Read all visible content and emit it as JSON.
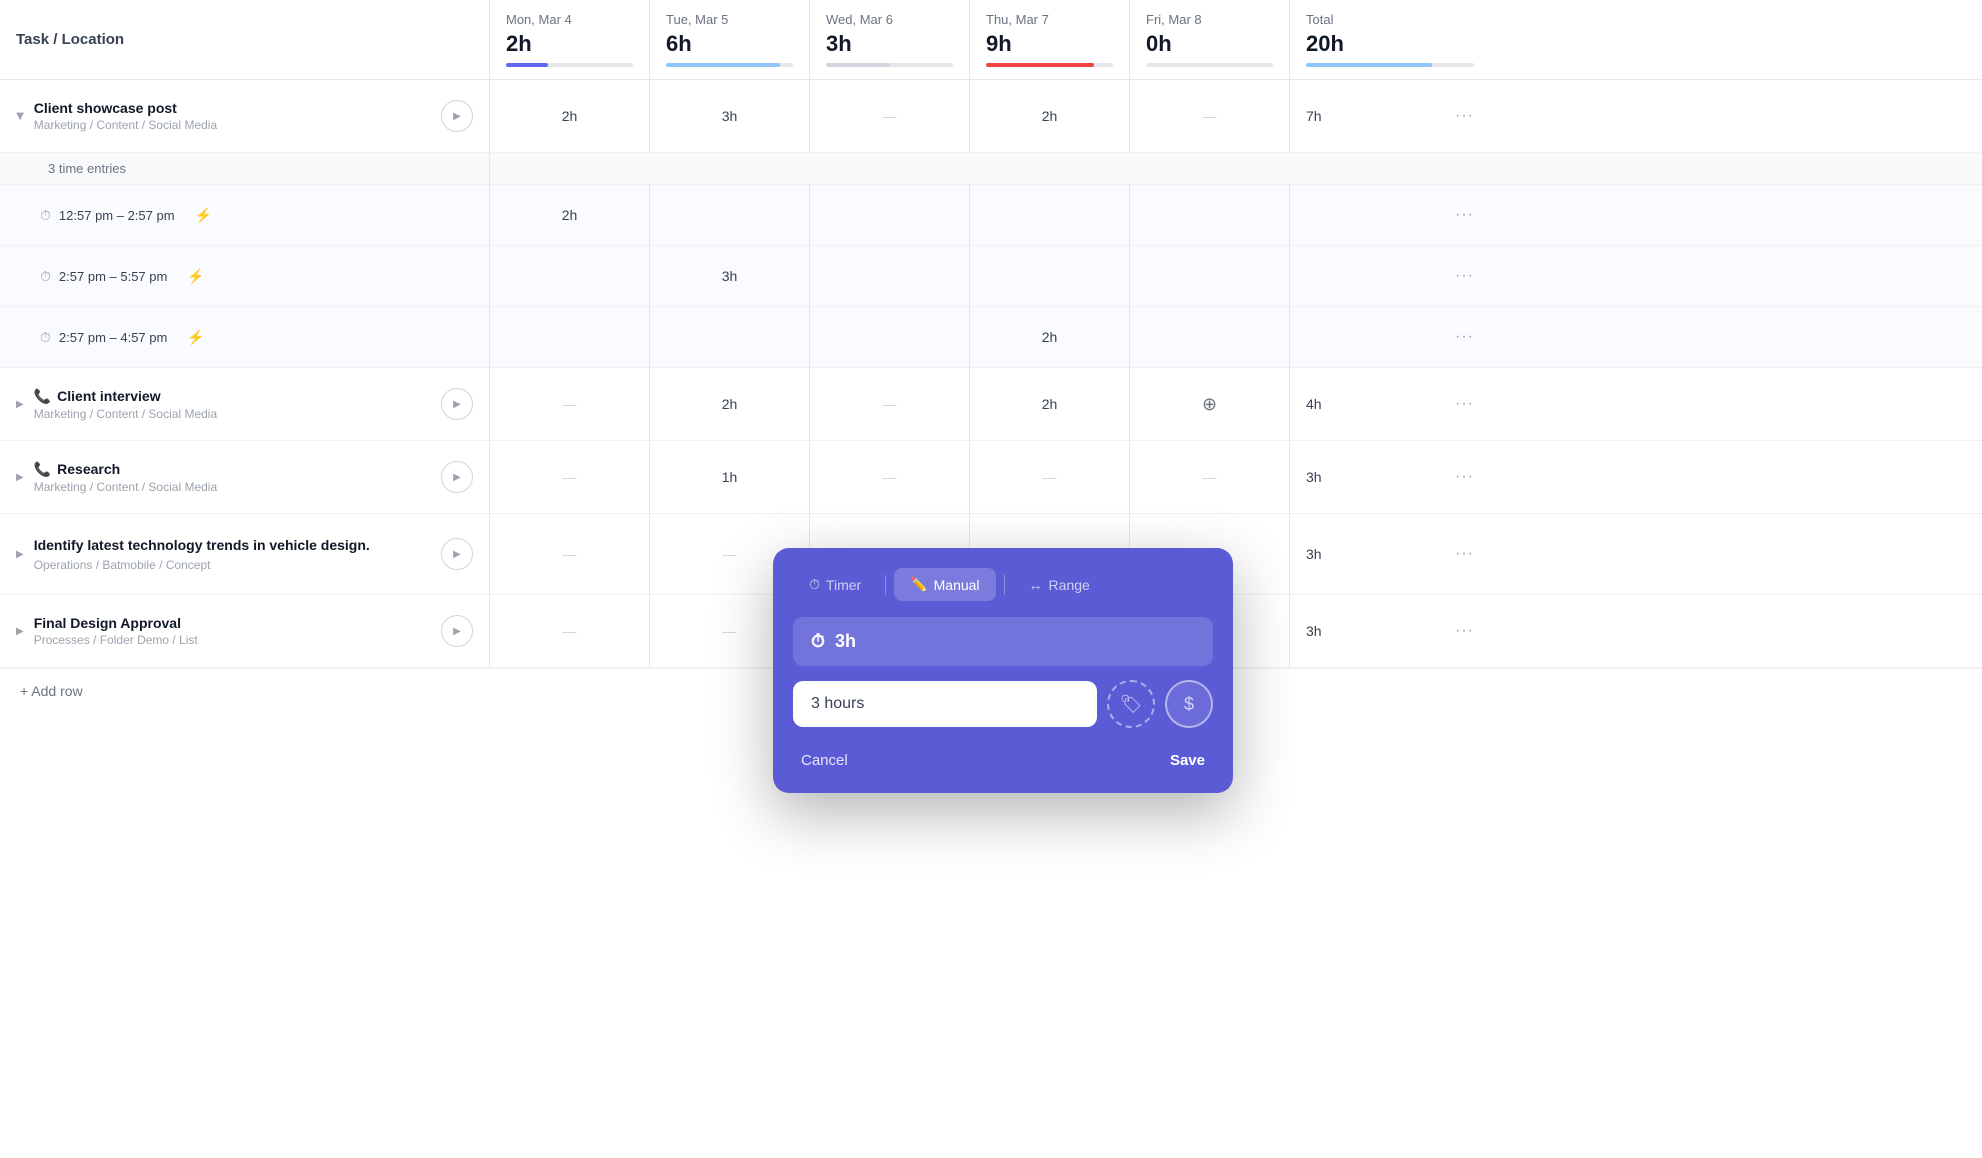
{
  "header": {
    "task_location_label": "Task / Location",
    "columns": [
      {
        "day": "Mon, Mar 4",
        "hours": "2h",
        "progress": 33,
        "color": "blue"
      },
      {
        "day": "Tue, Mar 5",
        "hours": "6h",
        "progress": 90,
        "color": "light-blue"
      },
      {
        "day": "Wed, Mar 6",
        "hours": "3h",
        "progress": 50,
        "color": "gray"
      },
      {
        "day": "Thu, Mar 7",
        "hours": "9h",
        "progress": 85,
        "color": "red"
      },
      {
        "day": "Fri, Mar 8",
        "hours": "0h",
        "progress": 0,
        "color": "gray"
      },
      {
        "day": "Total",
        "hours": "20h",
        "progress": 75,
        "color": "light-blue"
      }
    ]
  },
  "tasks": [
    {
      "id": "client-showcase",
      "name": "Client showcase post",
      "location": "Marketing / Content / Social Media",
      "expanded": true,
      "mon": "2h",
      "tue": "3h",
      "wed": "—",
      "thu": "2h",
      "fri": "—",
      "total": "7h",
      "icon": null,
      "time_entries_label": "3 time entries",
      "entries": [
        {
          "time": "12:57 pm – 2:57 pm",
          "mon": "2h",
          "tue": "",
          "wed": "",
          "thu": "",
          "fri": ""
        },
        {
          "time": "2:57 pm – 5:57 pm",
          "mon": "",
          "tue": "3h",
          "wed": "",
          "thu": "",
          "fri": ""
        },
        {
          "time": "2:57 pm – 4:57 pm",
          "mon": "",
          "tue": "",
          "wed": "",
          "thu": "2h",
          "fri": ""
        }
      ]
    },
    {
      "id": "client-interview",
      "name": "Client interview",
      "location": "Marketing / Content / Social Media",
      "expanded": false,
      "mon": "—",
      "tue": "2h",
      "wed": "—",
      "thu": "2h",
      "fri": "timer",
      "total": "4h",
      "icon": "phone"
    },
    {
      "id": "research",
      "name": "Research",
      "location": "Marketing / Content / Social Media",
      "expanded": false,
      "mon": "—",
      "tue": "1h",
      "wed": "—",
      "thu": "—",
      "fri": "—",
      "total": "3h",
      "icon": "phone"
    },
    {
      "id": "identify-trends",
      "name": "Identify latest technology trends in vehicle design.",
      "location": "Operations / Batmobile / Concept",
      "expanded": false,
      "mon": "—",
      "tue": "—",
      "wed": "—",
      "thu": "—",
      "fri": "—",
      "total": "3h",
      "icon": null,
      "multiline": true
    },
    {
      "id": "final-design",
      "name": "Final Design Approval",
      "location": "Processes / Folder Demo / List",
      "expanded": false,
      "mon": "—",
      "tue": "—",
      "wed": "—",
      "thu": "—",
      "fri": "—",
      "total": "3h",
      "icon": null
    }
  ],
  "add_row_label": "+ Add row",
  "popup": {
    "tabs": [
      {
        "id": "timer",
        "label": "Timer",
        "icon": "⏱"
      },
      {
        "id": "manual",
        "label": "Manual",
        "icon": "✏",
        "active": true
      },
      {
        "id": "range",
        "label": "Range",
        "icon": "↔"
      }
    ],
    "duration_display": "3h",
    "input_value": "3 hours",
    "input_placeholder": "3 hours",
    "cancel_label": "Cancel",
    "save_label": "Save"
  }
}
